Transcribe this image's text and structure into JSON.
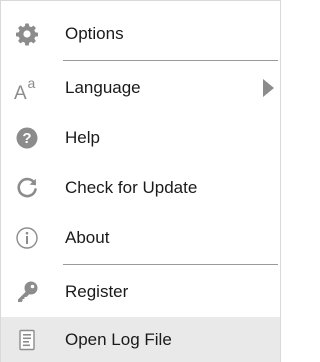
{
  "menu": {
    "items": [
      {
        "id": "options",
        "label": "Options",
        "icon": "gear-icon"
      },
      {
        "id": "language",
        "label": "Language",
        "icon": "font-size-icon",
        "has_submenu": true
      },
      {
        "id": "help",
        "label": "Help",
        "icon": "help-icon"
      },
      {
        "id": "check-for-update",
        "label": "Check for Update",
        "icon": "refresh-icon"
      },
      {
        "id": "about",
        "label": "About",
        "icon": "info-icon"
      },
      {
        "id": "register",
        "label": "Register",
        "icon": "key-icon"
      },
      {
        "id": "open-log-file",
        "label": "Open Log File",
        "icon": "log-file-icon",
        "highlighted": true
      }
    ],
    "icon_color": "#8c8c8c",
    "highlight_color": "#e9e9e9",
    "separators_after": [
      "options",
      "about"
    ]
  }
}
